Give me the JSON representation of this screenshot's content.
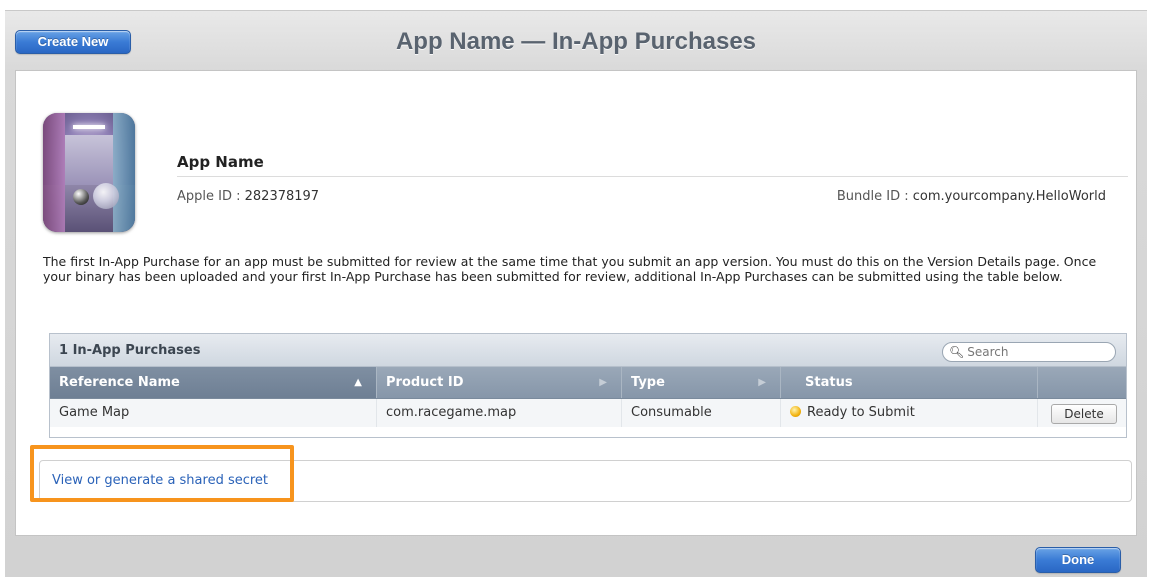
{
  "toolbar": {
    "create_new_label": "Create New",
    "title": "App Name — In-App Purchases",
    "done_label": "Done"
  },
  "app": {
    "name": "App Name",
    "apple_id_label": "Apple ID : ",
    "apple_id_value": "282378197",
    "bundle_id_label": "Bundle ID : ",
    "bundle_id_value": "com.yourcompany.HelloWorld",
    "icon": "app-icon-room-render"
  },
  "intro_text": "The first In-App Purchase for an app must be submitted for review at the same time that you submit an app version. You must do this on the Version Details page. Once your binary has been uploaded and your first In-App Purchase has been submitted for review, additional In-App Purchases can be submitted using the table below.",
  "table": {
    "count_label": "1 In-App Purchases",
    "search_placeholder": "Search",
    "columns": [
      "Reference Name",
      "Product ID",
      "Type",
      "Status",
      ""
    ],
    "rows": [
      {
        "reference_name": "Game Map",
        "product_id": "com.racegame.map",
        "type": "Consumable",
        "status": "Ready to Submit",
        "status_color": "#f2b20e",
        "action_label": "Delete"
      }
    ]
  },
  "shared_secret": {
    "link_label": "View or generate a shared secret",
    "highlight_color": "#f7941d"
  },
  "colors": {
    "accent_blue": "#3a7bd5",
    "link_blue": "#2a62b8",
    "title_gray": "#59636f"
  }
}
